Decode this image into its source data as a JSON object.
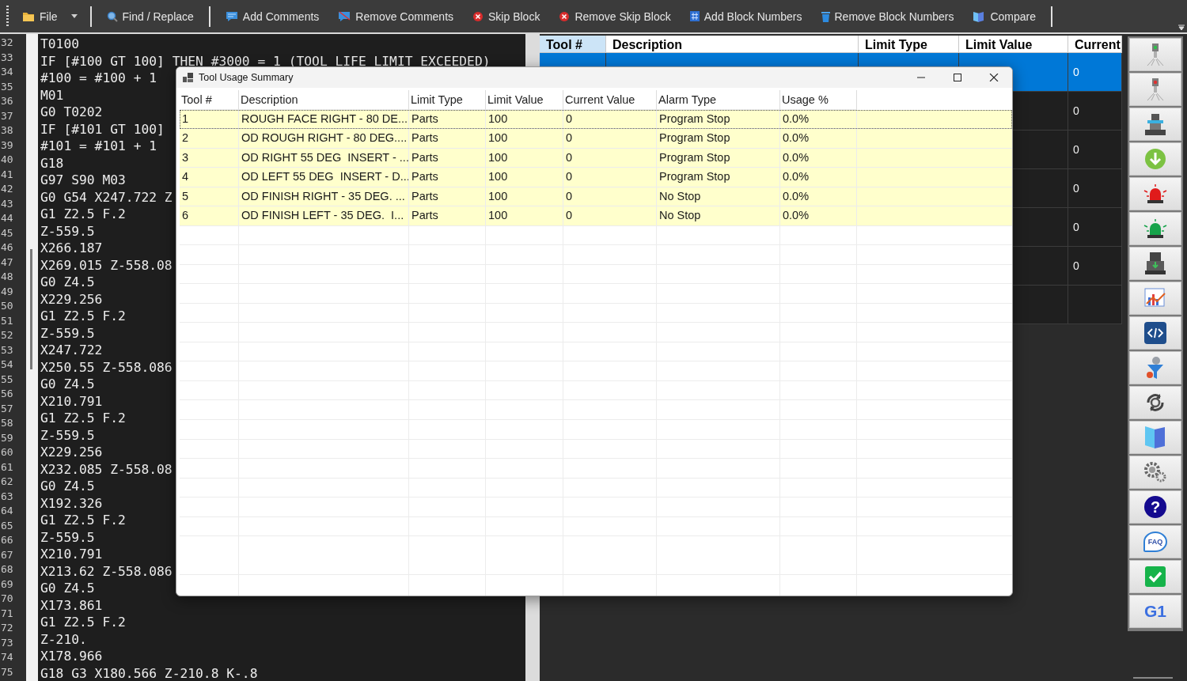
{
  "toolbar": {
    "items": [
      {
        "kind": "file",
        "label": "File",
        "dropdown": true
      },
      {
        "kind": "separator"
      },
      {
        "kind": "find",
        "label": "Find / Replace"
      },
      {
        "kind": "separator"
      },
      {
        "kind": "add-comment",
        "label": "Add Comments"
      },
      {
        "kind": "remove-comment",
        "label": "Remove Comments"
      },
      {
        "kind": "skip",
        "label": "Skip Block"
      },
      {
        "kind": "remove-skip",
        "label": "Remove Skip Block"
      },
      {
        "kind": "add-numbers",
        "label": "Add Block Numbers"
      },
      {
        "kind": "remove-numbers",
        "label": "Remove Block Numbers"
      },
      {
        "kind": "compare",
        "label": "Compare"
      },
      {
        "kind": "separator"
      }
    ]
  },
  "editor": {
    "line_numbers": [
      "32",
      "33",
      "34",
      "35",
      "36",
      "37",
      "38",
      "39",
      "40",
      "41",
      "42",
      "43",
      "44",
      "45",
      "46",
      "47",
      "48",
      "49",
      "50",
      "51",
      "52",
      "53",
      "54",
      "55",
      "56",
      "57",
      "58",
      "59",
      "60",
      "61",
      "62",
      "63",
      "64",
      "65",
      "66",
      "67",
      "68",
      "69",
      "70",
      "71",
      "72",
      "73",
      "74",
      "75"
    ],
    "lines": [
      "T0100",
      "IF [#100 GT 100] THEN #3000 = 1 (TOOL LIFE LIMIT EXCEEDED)",
      "#100 = #100 + 1",
      "M01",
      "G0 T0202",
      "IF [#101 GT 100]",
      "#101 = #101 + 1",
      "G18",
      "G97 S90 M03",
      "G0 G54 X247.722 Z",
      "G1 Z2.5 F.2",
      "Z-559.5",
      "X266.187",
      "X269.015 Z-558.08",
      "G0 Z4.5",
      "X229.256",
      "G1 Z2.5 F.2",
      "Z-559.5",
      "X247.722",
      "X250.55 Z-558.086",
      "G0 Z4.5",
      "X210.791",
      "G1 Z2.5 F.2",
      "Z-559.5",
      "X229.256",
      "X232.085 Z-558.08",
      "G0 Z4.5",
      "X192.326",
      "G1 Z2.5 F.2",
      "Z-559.5",
      "X210.791",
      "X213.62 Z-558.086",
      "G0 Z4.5",
      "X173.861",
      "G1 Z2.5 F.2",
      "Z-210.",
      "X178.966",
      "G18 G3 X180.566 Z-210.8 K-.8"
    ]
  },
  "tool_table": {
    "columns": [
      {
        "label": "Tool #",
        "selected": true
      },
      {
        "label": "Description",
        "selected": false
      },
      {
        "label": "Limit Type",
        "selected": false
      },
      {
        "label": "Limit Value",
        "selected": false
      },
      {
        "label": "Current",
        "selected": false
      }
    ],
    "rows": [
      {
        "selected": true,
        "current": "0"
      },
      {
        "selected": false,
        "current": "0"
      },
      {
        "selected": false,
        "current": "0"
      },
      {
        "selected": false,
        "current": "0"
      },
      {
        "selected": false,
        "current": "0"
      },
      {
        "selected": false,
        "current": "0"
      },
      {
        "selected": false
      }
    ]
  },
  "side_tools": [
    {
      "kind": "spindle-green"
    },
    {
      "kind": "spindle-red"
    },
    {
      "kind": "machine"
    },
    {
      "kind": "download"
    },
    {
      "kind": "siren-red"
    },
    {
      "kind": "siren-green"
    },
    {
      "kind": "printer"
    },
    {
      "kind": "chart"
    },
    {
      "kind": "code"
    },
    {
      "kind": "funnel"
    },
    {
      "kind": "cycle"
    },
    {
      "kind": "pages"
    },
    {
      "kind": "gears"
    },
    {
      "kind": "help",
      "label": "?"
    },
    {
      "kind": "faq",
      "label": "FAQ"
    },
    {
      "kind": "check"
    },
    {
      "kind": "text",
      "label": "G1"
    }
  ],
  "dialog": {
    "title": "Tool Usage Summary",
    "columns": [
      "Tool #",
      "Description",
      "Limit Type",
      "Limit Value",
      "Current Value",
      "Alarm Type",
      "Usage %"
    ],
    "rows": [
      {
        "focused": true,
        "cells": [
          "1",
          "ROUGH FACE RIGHT - 80 DE...",
          "Parts",
          "100",
          "0",
          "Program Stop",
          "0.0%"
        ]
      },
      {
        "focused": false,
        "cells": [
          "2",
          "OD ROUGH RIGHT - 80 DEG....",
          "Parts",
          "100",
          "0",
          "Program Stop",
          "0.0%"
        ]
      },
      {
        "focused": false,
        "cells": [
          "3",
          "OD RIGHT 55 DEG  INSERT - ...",
          "Parts",
          "100",
          "0",
          "Program Stop",
          "0.0%"
        ]
      },
      {
        "focused": false,
        "cells": [
          "4",
          "OD LEFT 55 DEG  INSERT - D...",
          "Parts",
          "100",
          "0",
          "Program Stop",
          "0.0%"
        ]
      },
      {
        "focused": false,
        "cells": [
          "5",
          "OD FINISH RIGHT - 35 DEG. ...",
          "Parts",
          "100",
          "0",
          "No Stop",
          "0.0%"
        ]
      },
      {
        "focused": false,
        "cells": [
          "6",
          "OD FINISH LEFT - 35 DEG.  I...",
          "Parts",
          "100",
          "0",
          "No Stop",
          "0.0%"
        ]
      }
    ]
  }
}
